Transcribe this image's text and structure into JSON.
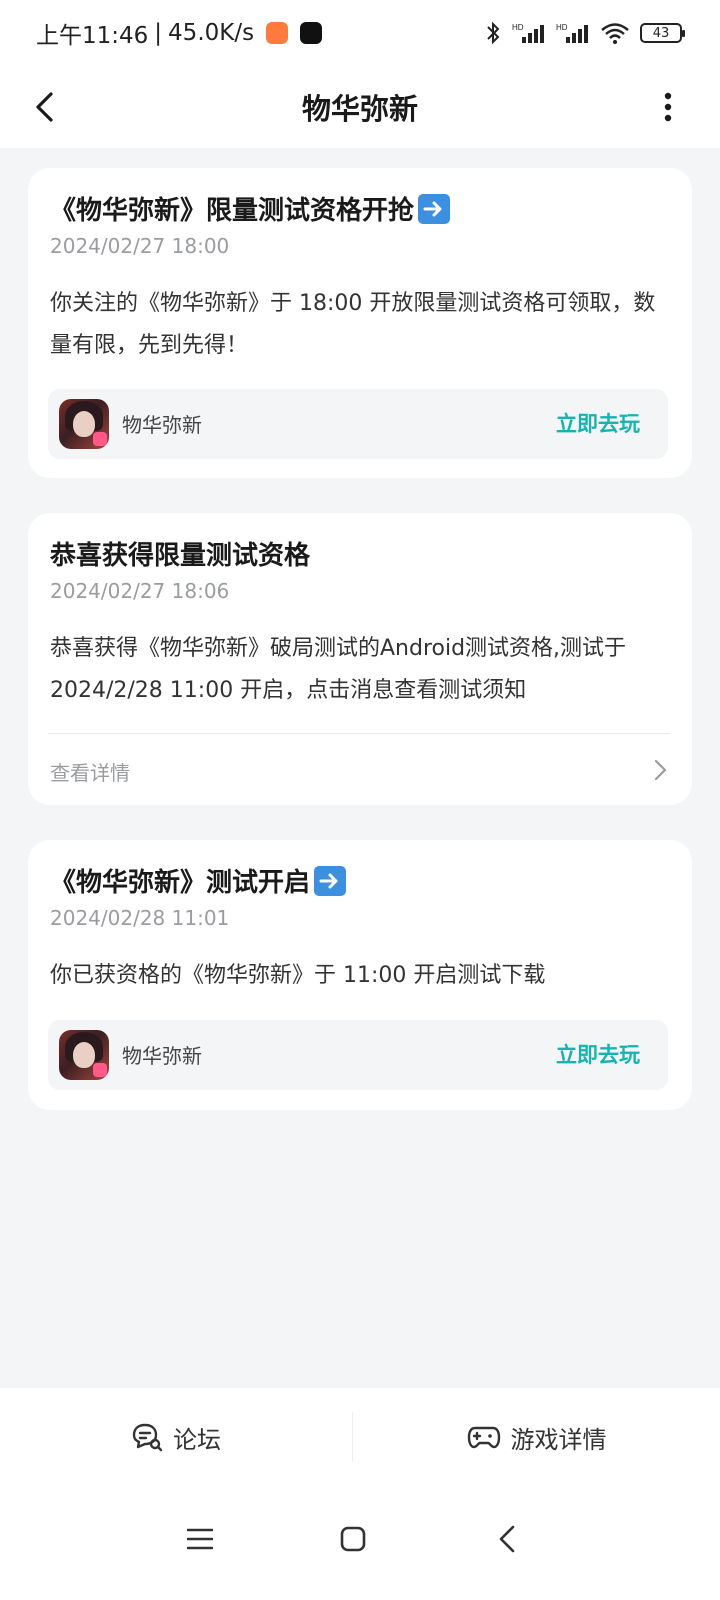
{
  "status_bar": {
    "time": "上午11:46",
    "net_speed": "45.0K/s",
    "battery": "43",
    "signal_label_1": "HD",
    "signal_label_2": "HD"
  },
  "header": {
    "title": "物华弥新"
  },
  "cards": [
    {
      "title": "《物华弥新》限量测试资格开抢",
      "time": "2024/02/27 18:00",
      "body": "你关注的《物华弥新》于 18:00 开放限量测试资格可领取，数量有限，先到先得！",
      "game_name": "物华弥新",
      "action_label": "立即去玩"
    },
    {
      "title": "恭喜获得限量测试资格",
      "time": "2024/02/27 18:06",
      "body": "恭喜获得《物华弥新》破局测试的Android测试资格,测试于 2024/2/28 11:00 开启，点击消息查看测试须知",
      "detail_label": "查看详情"
    },
    {
      "title": "《物华弥新》测试开启",
      "time": "2024/02/28 11:01",
      "body": "你已获资格的《物华弥新》于 11:00 开启测试下载",
      "game_name": "物华弥新",
      "action_label": "立即去玩"
    }
  ],
  "bottom_tabs": {
    "forum_label": "论坛",
    "game_detail_label": "游戏详情"
  },
  "colors": {
    "accent": "#16b3b0",
    "background": "#f4f5f7",
    "muted_text": "#9a9ca0"
  }
}
